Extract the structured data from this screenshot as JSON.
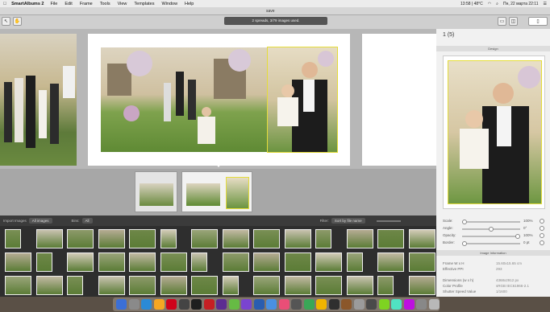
{
  "menubar": {
    "apple": "",
    "app_name": "SmartAlbums 2",
    "menus": [
      "File",
      "Edit",
      "Frame",
      "Tools",
      "View",
      "Templates",
      "Window",
      "Help"
    ],
    "status_text": "13:58 | 48°C",
    "status_right": "Пн, 22 марта 22:11"
  },
  "window": {
    "title": "save"
  },
  "status_pill": "2 spreads, 3/79 images used.",
  "sidebar": {
    "header": "1 (5)",
    "design_section": "Design",
    "sliders": [
      {
        "label": "Scale:",
        "value": "100%",
        "level": 0.0
      },
      {
        "label": "Angle:",
        "value": "0°",
        "level": 0.5
      },
      {
        "label": "Opacity:",
        "value": "100%",
        "level": 1.0
      },
      {
        "label": "Border:",
        "value": "0 pt",
        "level": 0.0
      }
    ],
    "image_info_section": "Image Information",
    "info": [
      {
        "label": "Frame W x H",
        "value": "15.60x15.65 cm"
      },
      {
        "label": "Effective PPI",
        "value": "293"
      },
      {
        "label": "Dimensions (w x h)",
        "value": "4368x2912 px"
      },
      {
        "label": "Color Profile",
        "value": "sRGB IEC61966-2.1"
      },
      {
        "label": "Shutter Speed Value",
        "value": "1/1600"
      }
    ]
  },
  "image_bar": {
    "import_label": "Import Images",
    "all_images": "All images",
    "bins_label": "Bins:",
    "bins_value": "All",
    "filter_label": "Filter:",
    "sort_value": "Sort by file name"
  },
  "colors": {
    "selection": "#e4dc3a",
    "sidebar_bg": "#f1f1f1",
    "canvas_bg": "#b7b7b7"
  }
}
